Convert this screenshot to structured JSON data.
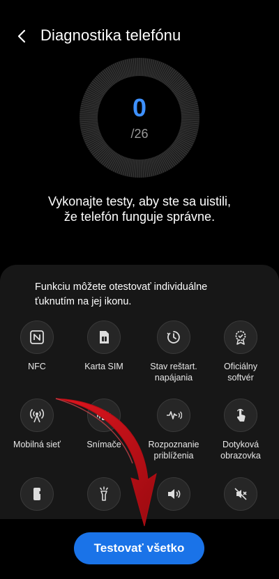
{
  "header": {
    "title": "Diagnostika telefónu"
  },
  "progress": {
    "done": "0",
    "total": "/26",
    "fraction": 0
  },
  "description": "Vykonajte testy, aby ste sa uistili, že telefón funguje správne.",
  "panel": {
    "hint": "Funkciu môžete otestovať individuálne ťuknutím na jej ikonu.",
    "tiles": [
      {
        "label": "NFC",
        "icon": "nfc-icon"
      },
      {
        "label": "Karta SIM",
        "icon": "sim-card-icon"
      },
      {
        "label": "Stav reštart.\nnapájania",
        "icon": "restart-icon"
      },
      {
        "label": "Oficiálny\nsoftvér",
        "icon": "badge-icon"
      },
      {
        "label": "Mobilná sieť",
        "icon": "signal-icon"
      },
      {
        "label": "Snímače",
        "icon": "vibration-icon"
      },
      {
        "label": "Rozpoznanie\npriblíženia",
        "icon": "proximity-icon"
      },
      {
        "label": "Dotyková\nobrazovka",
        "icon": "touch-icon"
      },
      {
        "label": "",
        "icon": "phone-icon"
      },
      {
        "label": "",
        "icon": "flashlight-icon"
      },
      {
        "label": "",
        "icon": "speaker-icon"
      },
      {
        "label": "",
        "icon": "mute-icon"
      }
    ]
  },
  "actions": {
    "test_all": "Testovať všetko"
  },
  "colors": {
    "accent": "#3e91ff",
    "button": "#1a73e8",
    "arrow": "#d0101a"
  }
}
